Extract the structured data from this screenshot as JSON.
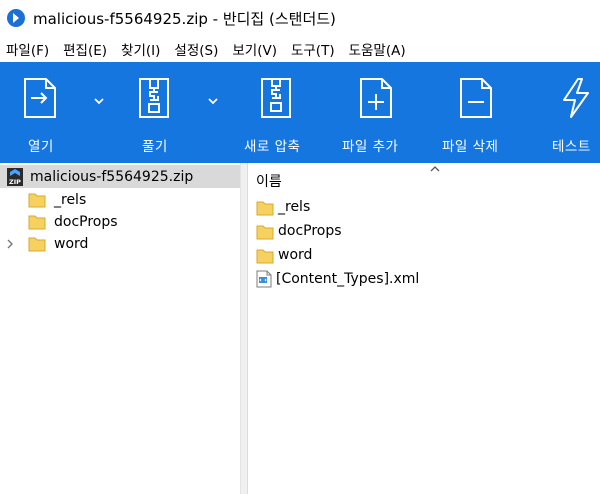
{
  "window": {
    "title": "malicious-f5564925.zip - 반디집 (스탠더드)"
  },
  "menu": [
    {
      "label": "파일(F)"
    },
    {
      "label": "편집(E)"
    },
    {
      "label": "찾기(I)"
    },
    {
      "label": "설정(S)"
    },
    {
      "label": "보기(V)"
    },
    {
      "label": "도구(T)"
    },
    {
      "label": "도움말(A)"
    }
  ],
  "toolbar": {
    "open": {
      "label": "열기",
      "icon": "open-archive-icon"
    },
    "extract": {
      "label": "풀기",
      "icon": "extract-icon"
    },
    "new_archive": {
      "label": "새로 압축",
      "icon": "new-archive-icon"
    },
    "add_file": {
      "label": "파일 추가",
      "icon": "add-file-icon"
    },
    "delete_file": {
      "label": "파일 삭제",
      "icon": "delete-file-icon"
    },
    "test": {
      "label": "테스트",
      "icon": "test-icon"
    }
  },
  "tree": {
    "root": "malicious-f5564925.zip",
    "children": [
      {
        "label": "_rels",
        "expandable": false
      },
      {
        "label": "docProps",
        "expandable": false
      },
      {
        "label": "word",
        "expandable": true
      }
    ]
  },
  "file_list": {
    "column_name": "이름",
    "items": [
      {
        "name": "_rels",
        "type": "folder"
      },
      {
        "name": "docProps",
        "type": "folder"
      },
      {
        "name": "word",
        "type": "folder"
      },
      {
        "name": "[Content_Types].xml",
        "type": "xml"
      }
    ]
  },
  "colors": {
    "toolbar_bg": "#1576e0",
    "selected_row": "#d9d9d9",
    "folder": "#f7d15f"
  }
}
